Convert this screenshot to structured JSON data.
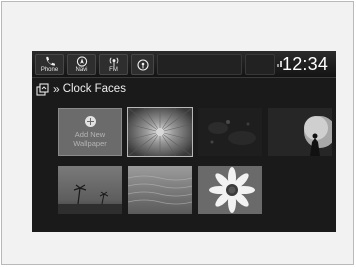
{
  "status_bar": {
    "sources": [
      {
        "label": "Phone",
        "icon": "phone-icon"
      },
      {
        "label": "Navi",
        "icon": "navi-icon"
      },
      {
        "label": "FM",
        "icon": "fm-radio-icon"
      },
      {
        "label": "",
        "icon": "audio-source-icon"
      }
    ],
    "status_icon": "signal-icon",
    "time": "12:34"
  },
  "header": {
    "back_icon": "back-icon",
    "separator": "»",
    "title": "Clock Faces"
  },
  "gallery": {
    "add_tile": {
      "line1": "Add New",
      "line2": "Wallpaper",
      "icon": "add-icon"
    },
    "wallpapers": [
      {
        "name": "wallpaper-radial-burst"
      },
      {
        "name": "wallpaper-dark-foliage"
      },
      {
        "name": "wallpaper-moon-figure"
      },
      {
        "name": "wallpaper-palm-beach"
      },
      {
        "name": "wallpaper-water-surface"
      },
      {
        "name": "wallpaper-daisy-flower"
      }
    ]
  },
  "colors": {
    "screen_bg": "#1a1a1a",
    "frame_bg": "#f2f2f2",
    "add_tile_bg": "#6b6b6b"
  }
}
